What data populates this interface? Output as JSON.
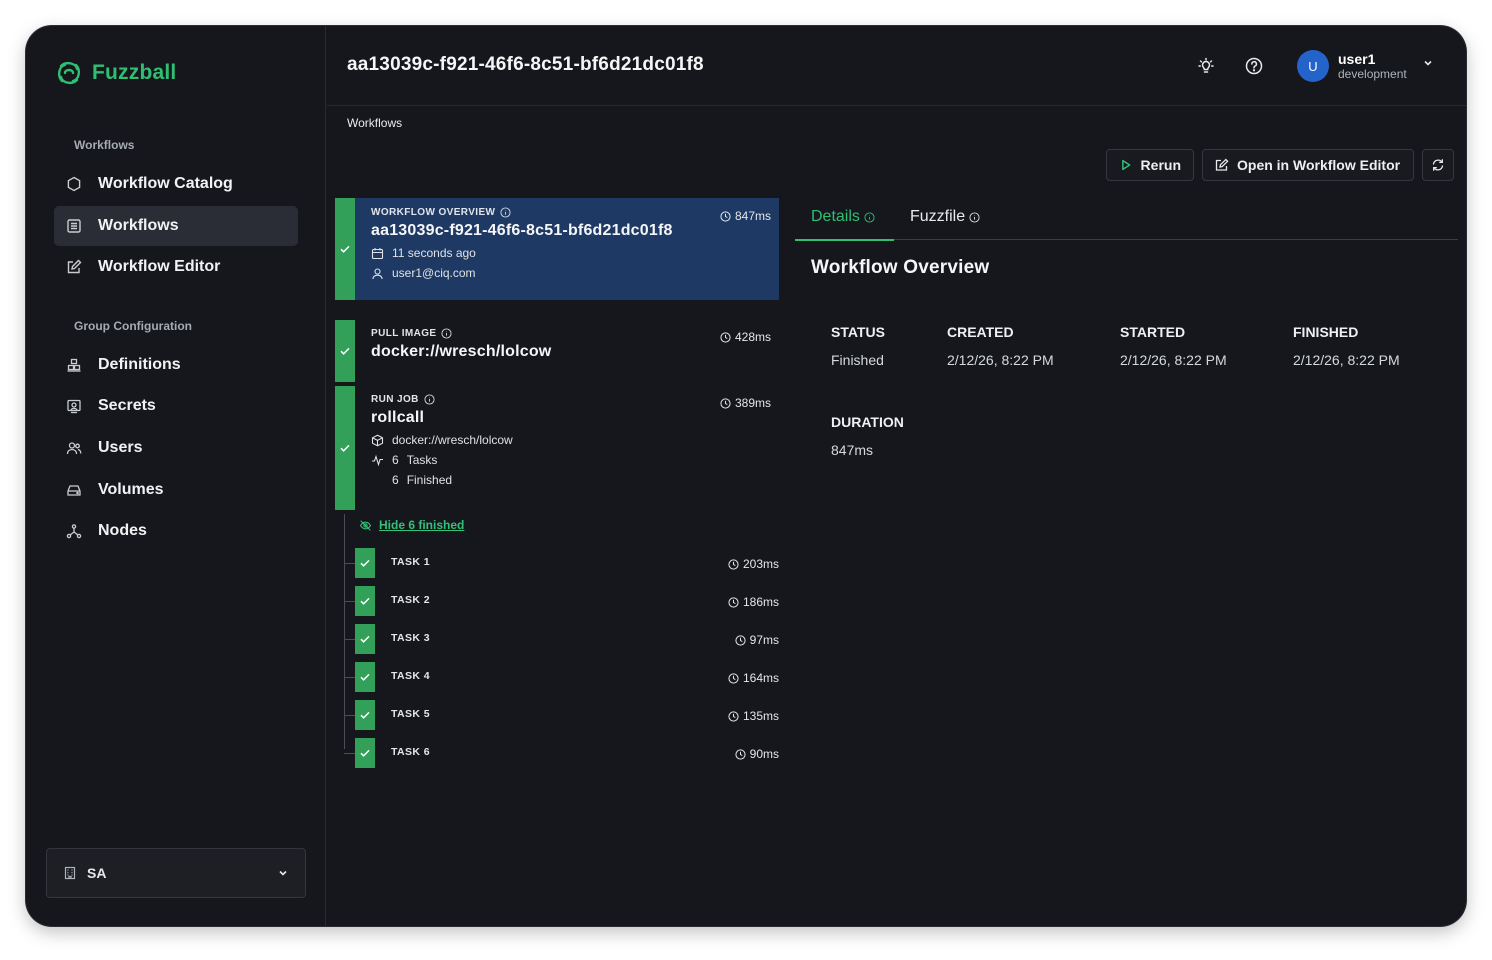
{
  "app": {
    "brand": "Fuzzball",
    "brand_color": "#2fbf71"
  },
  "sidebar": {
    "sections": [
      {
        "title": "Workflows",
        "items": [
          {
            "label": "Workflow Catalog",
            "icon": "hexagon-icon"
          },
          {
            "label": "Workflows",
            "icon": "list-icon",
            "active": true
          },
          {
            "label": "Workflow Editor",
            "icon": "edit-icon"
          }
        ]
      },
      {
        "title": "Group Configuration",
        "items": [
          {
            "label": "Definitions",
            "icon": "boxes-icon"
          },
          {
            "label": "Secrets",
            "icon": "key-card-icon"
          },
          {
            "label": "Users",
            "icon": "users-icon"
          },
          {
            "label": "Volumes",
            "icon": "drive-icon"
          },
          {
            "label": "Nodes",
            "icon": "network-icon"
          }
        ]
      }
    ],
    "org_select": {
      "value": "SA"
    }
  },
  "header": {
    "title": "aa13039c-f921-46f6-8c51-bf6d21dc01f8",
    "user": {
      "initial": "U",
      "name": "user1",
      "env": "development"
    }
  },
  "breadcrumb": "Workflows",
  "actions": {
    "rerun": "Rerun",
    "open_editor": "Open in Workflow Editor"
  },
  "overview_card": {
    "kind": "WORKFLOW OVERVIEW",
    "title": "aa13039c-f921-46f6-8c51-bf6d21dc01f8",
    "duration": "847ms",
    "time_ago": "11 seconds ago",
    "user": "user1@ciq.com"
  },
  "pull_image": {
    "kind": "PULL IMAGE",
    "title": "docker://wresch/lolcow",
    "duration": "428ms"
  },
  "run_job": {
    "kind": "RUN JOB",
    "title": "rollcall",
    "duration": "389ms",
    "image": "docker://wresch/lolcow",
    "tasks_count": "6",
    "tasks_label": "Tasks",
    "finished_count": "6",
    "finished_label": "Finished"
  },
  "hide_finished": "Hide 6 finished",
  "tasks": [
    {
      "name": "TASK 1",
      "duration": "203ms"
    },
    {
      "name": "TASK 2",
      "duration": "186ms"
    },
    {
      "name": "TASK 3",
      "duration": "97ms"
    },
    {
      "name": "TASK 4",
      "duration": "164ms"
    },
    {
      "name": "TASK 5",
      "duration": "135ms"
    },
    {
      "name": "TASK 6",
      "duration": "90ms"
    }
  ],
  "tabs": [
    {
      "label": "Details",
      "active": true
    },
    {
      "label": "Fuzzfile"
    }
  ],
  "details": {
    "title": "Workflow Overview",
    "fields": [
      {
        "label": "STATUS",
        "value": "Finished"
      },
      {
        "label": "CREATED",
        "value": "2/12/26, 8:22 PM"
      },
      {
        "label": "STARTED",
        "value": "2/12/26, 8:22 PM"
      },
      {
        "label": "FINISHED",
        "value": "2/12/26, 8:22 PM"
      },
      {
        "label": "DURATION",
        "value": "847ms"
      }
    ]
  }
}
